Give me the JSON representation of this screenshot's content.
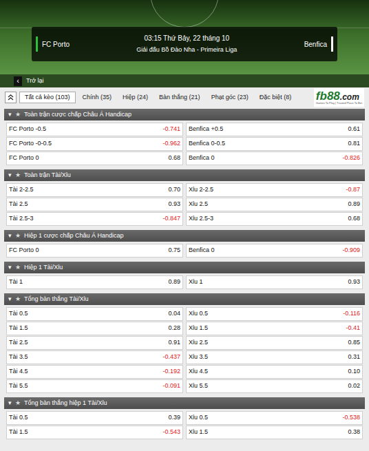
{
  "match": {
    "home": "FC Porto",
    "time": "03:15 Thứ Bảy, 22 tháng 10",
    "league": "Giải đấu Bồ Đào Nha - Primeira Liga",
    "away": "Benfica"
  },
  "back": {
    "icon": "‹",
    "label": "Trở lại"
  },
  "tabs": [
    {
      "label": "Tất cả kèo (103)",
      "selected": true
    },
    {
      "label": "Chính (35)",
      "selected": false
    },
    {
      "label": "Hiệp (24)",
      "selected": false
    },
    {
      "label": "Bàn thắng (21)",
      "selected": false
    },
    {
      "label": "Phạt góc (23)",
      "selected": false
    },
    {
      "label": "Đặc biệt (8)",
      "selected": false
    }
  ],
  "logo": {
    "brand": "fb88",
    "domain": ".com",
    "tagline": "Games To Play | Trusted Place To Bet"
  },
  "sections": [
    {
      "toggle": "▾",
      "star": "★",
      "title": "Toàn trận cược chấp Châu Á Handicap",
      "rows": [
        [
          {
            "label": "FC Porto -0.5",
            "value": "-0.741",
            "negative": true
          },
          {
            "label": "Benfica +0.5",
            "value": "0.61",
            "negative": false
          }
        ],
        [
          {
            "label": "FC Porto -0-0.5",
            "value": "-0.962",
            "negative": true
          },
          {
            "label": "Benfica 0-0.5",
            "value": "0.81",
            "negative": false
          }
        ],
        [
          {
            "label": "FC Porto 0",
            "value": "0.68",
            "negative": false
          },
          {
            "label": "Benfica 0",
            "value": "-0.826",
            "negative": true
          }
        ]
      ]
    },
    {
      "toggle": "▾",
      "star": "★",
      "title": "Toàn trận Tài/Xỉu",
      "rows": [
        [
          {
            "label": "Tài 2-2.5",
            "value": "0.70",
            "negative": false
          },
          {
            "label": "Xỉu 2-2.5",
            "value": "-0.87",
            "negative": true
          }
        ],
        [
          {
            "label": "Tài 2.5",
            "value": "0.93",
            "negative": false
          },
          {
            "label": "Xỉu 2.5",
            "value": "0.89",
            "negative": false
          }
        ],
        [
          {
            "label": "Tài 2.5-3",
            "value": "-0.847",
            "negative": true
          },
          {
            "label": "Xỉu 2.5-3",
            "value": "0.68",
            "negative": false
          }
        ]
      ]
    },
    {
      "toggle": "▾",
      "star": "★",
      "title": "Hiệp 1 cược chấp Châu Á Handicap",
      "rows": [
        [
          {
            "label": "FC Porto 0",
            "value": "0.75",
            "negative": false
          },
          {
            "label": "Benfica 0",
            "value": "-0.909",
            "negative": true
          }
        ]
      ]
    },
    {
      "toggle": "▾",
      "star": "★",
      "title": "Hiệp 1 Tài/Xỉu",
      "rows": [
        [
          {
            "label": "Tài 1",
            "value": "0.89",
            "negative": false
          },
          {
            "label": "Xỉu 1",
            "value": "0.93",
            "negative": false
          }
        ]
      ]
    },
    {
      "toggle": "▾",
      "star": "★",
      "title": "Tổng bàn thắng Tài/Xỉu",
      "rows": [
        [
          {
            "label": "Tài 0.5",
            "value": "0.04",
            "negative": false
          },
          {
            "label": "Xỉu 0.5",
            "value": "-0.116",
            "negative": true
          }
        ],
        [
          {
            "label": "Tài 1.5",
            "value": "0.28",
            "negative": false
          },
          {
            "label": "Xỉu 1.5",
            "value": "-0.41",
            "negative": true
          }
        ],
        [
          {
            "label": "Tài 2.5",
            "value": "0.91",
            "negative": false
          },
          {
            "label": "Xỉu 2.5",
            "value": "0.85",
            "negative": false
          }
        ],
        [
          {
            "label": "Tài 3.5",
            "value": "-0.437",
            "negative": true
          },
          {
            "label": "Xỉu 3.5",
            "value": "0.31",
            "negative": false
          }
        ],
        [
          {
            "label": "Tài 4.5",
            "value": "-0.192",
            "negative": true
          },
          {
            "label": "Xỉu 4.5",
            "value": "0.10",
            "negative": false
          }
        ],
        [
          {
            "label": "Tài 5.5",
            "value": "-0.091",
            "negative": true
          },
          {
            "label": "Xỉu 5.5",
            "value": "0.02",
            "negative": false
          }
        ]
      ]
    },
    {
      "toggle": "▾",
      "star": "★",
      "title": "Tổng bàn thắng hiệp 1 Tài/Xỉu",
      "rows": [
        [
          {
            "label": "Tài 0.5",
            "value": "0.39",
            "negative": false
          },
          {
            "label": "Xỉu 0.5",
            "value": "-0.538",
            "negative": true
          }
        ],
        [
          {
            "label": "Tài 1.5",
            "value": "-0.543",
            "negative": true
          },
          {
            "label": "Xỉu 1.5",
            "value": "0.38",
            "negative": false
          }
        ]
      ]
    }
  ]
}
